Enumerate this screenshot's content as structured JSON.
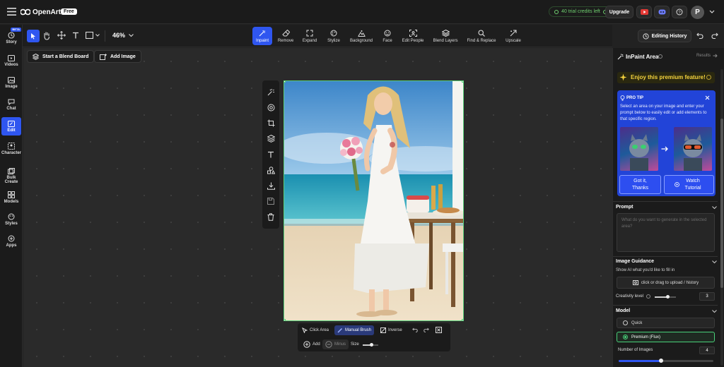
{
  "app": {
    "name": "OpenArt",
    "badge": "Free"
  },
  "top": {
    "credits": "40 trial credits left",
    "upgrade": "Upgrade",
    "avatar_initial": "P",
    "editing_history": "Editing History"
  },
  "zoom": "46%",
  "tools": [
    {
      "label": "Inpaint",
      "icon": "inpaint-icon"
    },
    {
      "label": "Remove",
      "icon": "eraser-icon"
    },
    {
      "label": "Expand",
      "icon": "expand-icon"
    },
    {
      "label": "Stylize",
      "icon": "palette-icon"
    },
    {
      "label": "Background",
      "icon": "background-icon"
    },
    {
      "label": "Face",
      "icon": "face-icon"
    },
    {
      "label": "Edit People",
      "icon": "edit-people-icon"
    },
    {
      "label": "Blend Layers",
      "icon": "layers-icon"
    },
    {
      "label": "Find & Replace",
      "icon": "search-icon"
    },
    {
      "label": "Upscale",
      "icon": "upscale-icon"
    }
  ],
  "sidebar": {
    "beta": "BETA",
    "items": [
      {
        "label": "Story",
        "icon": "story-icon"
      },
      {
        "label": "Videos",
        "icon": "video-icon"
      },
      {
        "label": "Image",
        "icon": "image-icon"
      },
      {
        "label": "Chat",
        "icon": "chat-icon"
      },
      {
        "label": "Edit",
        "icon": "edit-icon"
      },
      {
        "label": "Character",
        "icon": "character-icon"
      },
      {
        "label": "Bulk Create",
        "icon": "bulk-icon"
      },
      {
        "label": "Models",
        "icon": "models-icon"
      },
      {
        "label": "Styles",
        "icon": "styles-icon"
      },
      {
        "label": "Apps",
        "icon": "apps-icon"
      }
    ]
  },
  "canvas": {
    "blend_board": "Start a Blend Board",
    "add_image": "Add Image"
  },
  "brush": {
    "click_area": "Click Area",
    "manual_brush": "Manual Brush",
    "inverse": "Inverse",
    "add": "Add",
    "minus": "Minus",
    "size_label": "Size",
    "size_value": 0.55
  },
  "panel": {
    "title": "InPaint Area",
    "results": "Results",
    "premium": "Enjoy this premium feature!",
    "protip_title": "PRO TIP",
    "protip_text": "Select an area on your image and enter your prompt below to easily edit or add elements to that specific region.",
    "got_it": "Got it, Thanks",
    "watch": "Watch Tutorial",
    "prompt_label": "Prompt",
    "prompt_placeholder": "What do you want to generate in the selected area?",
    "guidance_label": "Image Guidance",
    "guidance_sub": "Show AI what you'd like to fill in",
    "upload": "click or drag to upload / history",
    "creativity_label": "Creativity level",
    "creativity_value": "3",
    "creativity_fraction": 0.6,
    "model_label": "Model",
    "model_quick": "Quick",
    "model_premium": "Premium (Flux)",
    "num_images_label": "Number of Images",
    "num_images_value": "4",
    "num_images_fraction": 0.45
  },
  "colors": {
    "accent": "#2f56f0",
    "success": "#49d17a",
    "premium": "#f5d33d"
  }
}
